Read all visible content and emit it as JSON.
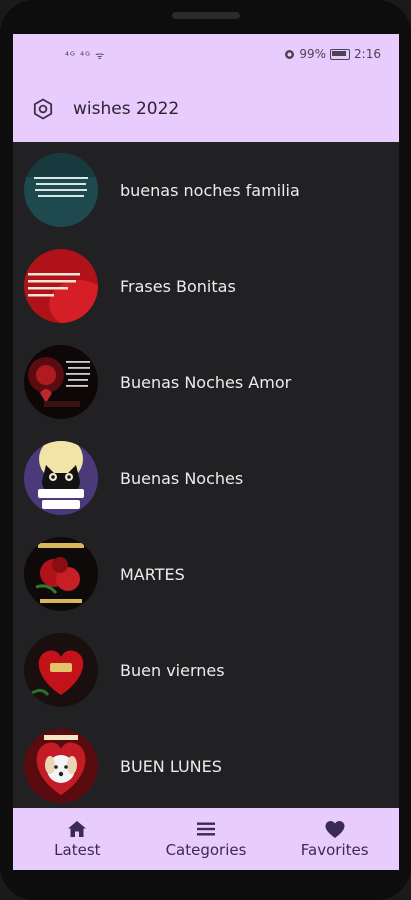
{
  "status_bar": {
    "left_icons": "⁴ᴳ ⁴ᴳ ᯤ",
    "battery_percent": "99%",
    "time": "2:16"
  },
  "app_bar": {
    "icon": "gear-icon",
    "title": "wishes 2022"
  },
  "list": {
    "items": [
      {
        "label": "buenas noches familia",
        "thumb": "teal-quote-card"
      },
      {
        "label": "Frases Bonitas",
        "thumb": "red-quote-card"
      },
      {
        "label": "Buenas Noches Amor",
        "thumb": "night-heart-card"
      },
      {
        "label": "Buenas Noches",
        "thumb": "black-cat-card"
      },
      {
        "label": "MARTES",
        "thumb": "red-rose-card"
      },
      {
        "label": "Buen viernes",
        "thumb": "red-heart-card"
      },
      {
        "label": "BUEN LUNES",
        "thumb": "puppy-heart-card"
      }
    ]
  },
  "bottom_nav": {
    "latest": {
      "label": "Latest",
      "icon": "home-icon"
    },
    "categories": {
      "label": "Categories",
      "icon": "menu-icon"
    },
    "favorites": {
      "label": "Favorites",
      "icon": "heart-icon"
    }
  },
  "colors": {
    "accent": "#e8ccfe",
    "background": "#212023",
    "nav_icon": "#3a2a57"
  }
}
